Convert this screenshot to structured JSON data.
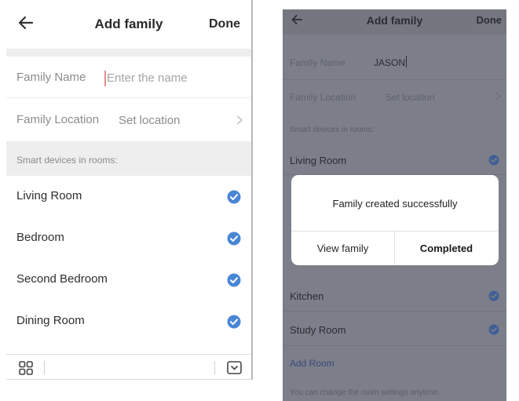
{
  "left_screen": {
    "header": {
      "title": "Add family",
      "done_label": "Done",
      "back_icon": "back-arrow-icon"
    },
    "family_name": {
      "label": "Family Name",
      "placeholder": "Enter the name",
      "value": ""
    },
    "family_location": {
      "label": "Family Location",
      "value": "Set location"
    },
    "rooms_section_label": "Smart devices in rooms:",
    "rooms": [
      {
        "name": "Living Room",
        "checked": true
      },
      {
        "name": "Bedroom",
        "checked": true
      },
      {
        "name": "Second Bedroom",
        "checked": true
      },
      {
        "name": "Dining Room",
        "checked": true
      }
    ],
    "keyboard_bar": {
      "left_icon": "grid-icon",
      "right_icon": "keyboard-hide-icon"
    }
  },
  "right_screen": {
    "header": {
      "title": "Add family",
      "done_label": "Done",
      "back_icon": "back-arrow-icon"
    },
    "family_name": {
      "label": "Family Name",
      "value": "JASON"
    },
    "family_location": {
      "label": "Family Location",
      "value": "Set location"
    },
    "rooms_section_label": "Smart devices in rooms:",
    "rooms": [
      {
        "name": "Living Room",
        "checked": true
      },
      {
        "name": "Kitchen",
        "checked": true
      },
      {
        "name": "Study Room",
        "checked": true
      }
    ],
    "add_room_label": "Add Room",
    "hint": "You can change the room settings anytime.",
    "dialog": {
      "message": "Family created successfully",
      "view_family_label": "View family",
      "completed_label": "Completed"
    }
  },
  "colors": {
    "check_blue": "#4a86d6",
    "overlay": "#7c7f8a",
    "section_bg": "#eeeeee"
  }
}
